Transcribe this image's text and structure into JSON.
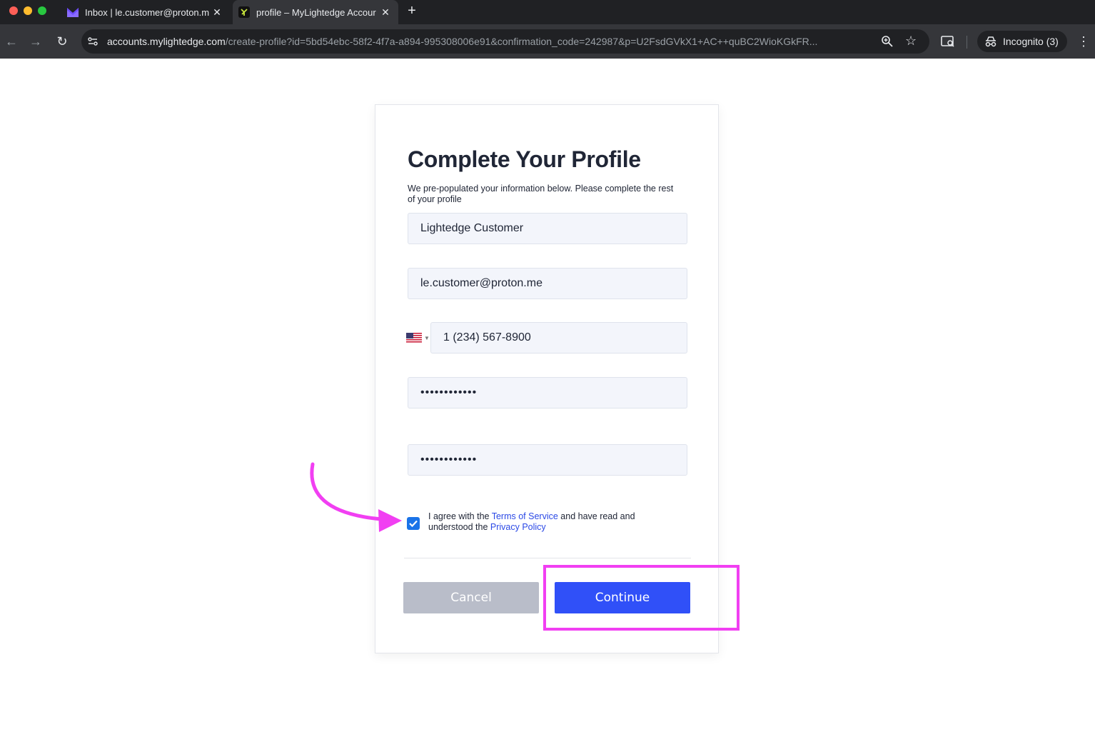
{
  "browser": {
    "tabs": [
      {
        "title": "Inbox | le.customer@proton.m",
        "icon": "proton-mail-icon",
        "active": false
      },
      {
        "title": "profile – MyLightedge Accour",
        "icon": "lightedge-icon",
        "active": true
      }
    ],
    "new_tab_label": "+",
    "url_host": "accounts.mylightedge.com",
    "url_path": "/create-profile?id=5bd54ebc-58f2-4f7a-a894-995308006e91&confirmation_code=242987&p=U2FsdGVkX1+AC++quBC2WioKGkFR...",
    "incognito_label": "Incognito (3)"
  },
  "form": {
    "title": "Complete Your Profile",
    "intro": "We pre-populated your information below. Please complete the rest of your profile",
    "name_value": "Lightedge Customer",
    "email_value": "le.customer@proton.me",
    "phone_value": "1 (234) 567-8900",
    "phone_country": "US",
    "password_value": "••••••••••••",
    "confirm_password_value": "••••••••••••",
    "agree_prefix": "I agree with the ",
    "terms_link": "Terms of Service",
    "agree_middle": " and have read and understood the ",
    "privacy_link": "Privacy Policy",
    "agree_checked": true,
    "cancel_label": "Cancel",
    "continue_label": "Continue"
  },
  "colors": {
    "primary": "#3050f8",
    "cancel": "#b9bdc9",
    "annotation": "#f13ff2",
    "link": "#2b49e6"
  }
}
